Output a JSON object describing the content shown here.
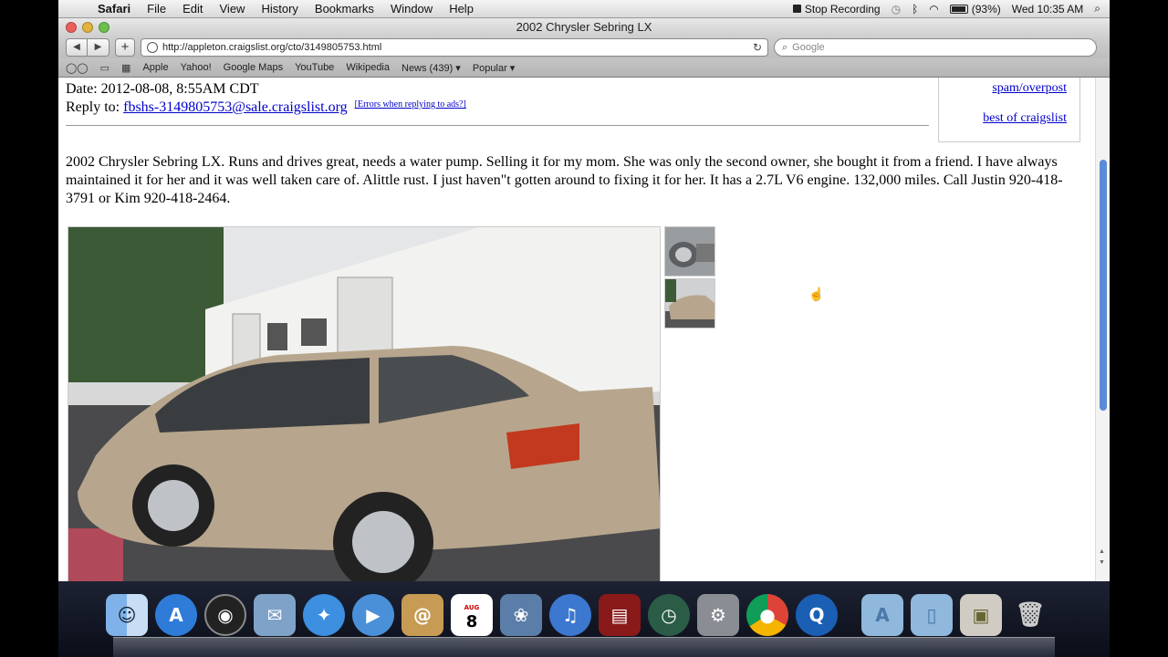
{
  "menubar": {
    "app": "Safari",
    "items": [
      "File",
      "Edit",
      "View",
      "History",
      "Bookmarks",
      "Window",
      "Help"
    ],
    "stop_recording": "Stop Recording",
    "battery": "(93%)",
    "clock": "Wed 10:35 AM"
  },
  "window": {
    "title": "2002 Chrysler Sebring LX",
    "url": "http://appleton.craigslist.org/cto/3149805753.html",
    "search_placeholder": "Google"
  },
  "bookmarks": [
    "Apple",
    "Yahoo!",
    "Google Maps",
    "YouTube",
    "Wikipedia",
    "News (439) ▾",
    "Popular ▾"
  ],
  "listing": {
    "date": "Date: 2012-08-08, 8:55AM CDT",
    "reply_label": "Reply to:",
    "reply_email": "fbshs-3149805753@sale.craigslist.org",
    "errors_link": "[Errors when replying to ads?]",
    "body": "2002 Chrysler Sebring LX. Runs and drives great, needs a water pump. Selling it for my mom. She was only the second owner, she bought it from a friend. I have always maintained it for her and it was well taken care of. Alittle rust. I just haven\"t gotten around to fixing it for her. It has a 2.7L V6 engine. 132,000 miles. Call Justin 920-418-3791 or Kim 920-418-2464.",
    "side_links": [
      "spam/overpost",
      "best of craigslist"
    ]
  },
  "dock": {
    "calendar_day": "8",
    "calendar_month": "AUG"
  }
}
